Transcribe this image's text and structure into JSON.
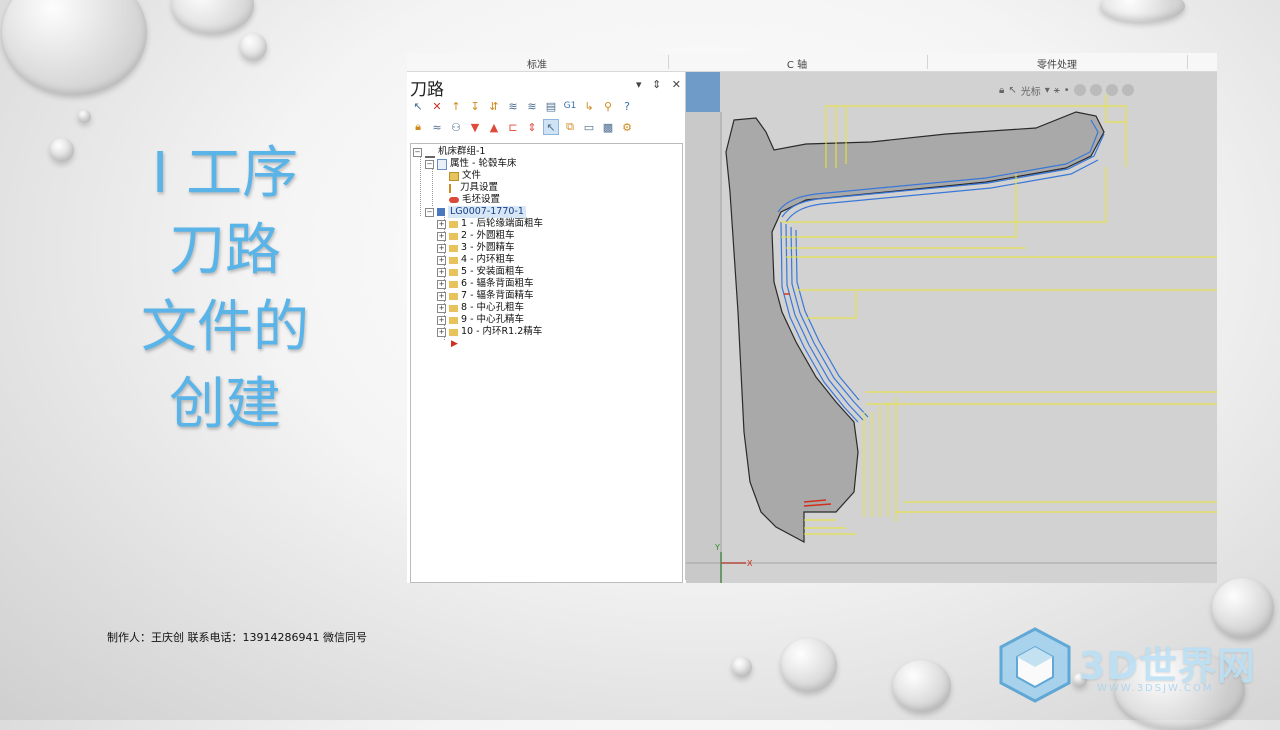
{
  "slide": {
    "title_lines": [
      "I  工序",
      "刀路",
      "文件的",
      "创建"
    ],
    "credit": "制作人：王庆创 联系电话：13914286941  微信同号",
    "colors": {
      "title": "#5ab4e8",
      "background": "#e6e6e6"
    }
  },
  "ribbon": {
    "groups": [
      "标准",
      "C 轴",
      "零件处理"
    ]
  },
  "toolpath_panel": {
    "title": "刀路",
    "controls": [
      "▾",
      "⇕",
      "✕"
    ],
    "toolbar_icons_row1": [
      "select-all-icon",
      "deselect-icon",
      "select-ops-icon",
      "toggle-icon",
      "sort-icon",
      "regen-all-icon",
      "regen-dirty-icon",
      "backplot-icon",
      "verify-icon",
      "g1-post-icon",
      "lock-icon",
      "help-icon"
    ],
    "toolbar_icons_row2": [
      "lock-icon",
      "toggle-display-icon",
      "post-icon",
      "move-down-icon",
      "move-up-icon",
      "insert-icon",
      "expand-icon",
      "select-icon",
      "copy-icon",
      "options-icon",
      "filter-icon",
      "settings-icon"
    ],
    "tree": {
      "root": "机床群组-1",
      "properties": "属性 - 轮毂车床",
      "files": "文件",
      "tool_settings": "刀具设置",
      "stock_settings": "毛坯设置",
      "group": "LG0007-1770-1",
      "operations": [
        "1 - 后轮缘端面粗车",
        "2 - 外圆粗车",
        "3 - 外圆精车",
        "4 - 内环粗车",
        "5 - 安装面粗车",
        "6 - 辐条背面粗车",
        "7 - 辐条背面精车",
        "8 - 中心孔粗车",
        "9 - 中心孔精车",
        "10 - 内环R1.2精车"
      ]
    }
  },
  "viewport": {
    "toolbar_label": "光标",
    "axis_labels": {
      "x": "X",
      "y": "Y"
    },
    "colors": {
      "background": "#c9c9c9",
      "part": "#a6a6a6",
      "toolpath_blue": "#3a78d8",
      "toolpath_yellow": "#e9e62c"
    }
  },
  "watermark": {
    "brand": "3D世界网",
    "url": "WWW.3DSJW.COM"
  }
}
